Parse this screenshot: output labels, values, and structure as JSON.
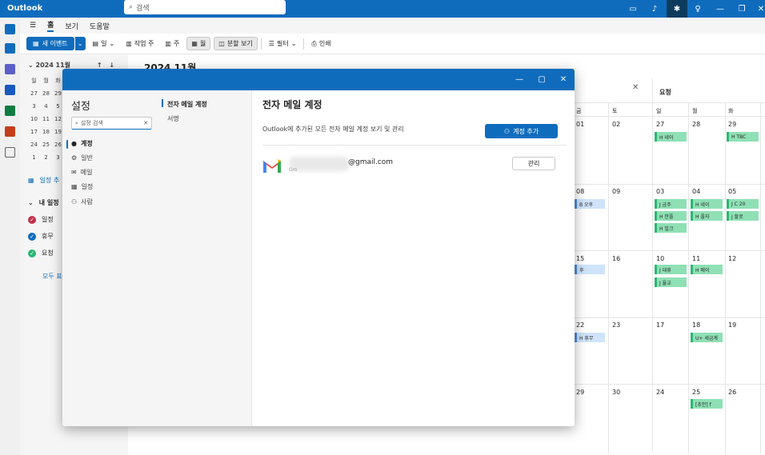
{
  "app": {
    "title": "Outlook"
  },
  "search": {
    "placeholder": "검색"
  },
  "menu": {
    "items": [
      "홈",
      "보기",
      "도움말"
    ],
    "active": "홈"
  },
  "ribbon": {
    "new_event": "새 이벤트",
    "day": "일",
    "work_week": "작업 주",
    "week": "주",
    "month": "월",
    "split_view": "분할 보기",
    "filter": "필터",
    "print": "인쇄"
  },
  "leftnav": {
    "month_label": "2024 11월",
    "weekdays": [
      "일",
      "월",
      "화"
    ],
    "weeks": [
      [
        "27",
        "28",
        "29"
      ],
      [
        "3",
        "4",
        "5"
      ],
      [
        "10",
        "11",
        "12"
      ],
      [
        "17",
        "18",
        "19"
      ],
      [
        "24",
        "25",
        "26"
      ],
      [
        "1",
        "2",
        "3"
      ]
    ],
    "add_calendar": "일정 추",
    "my_calendars": "내 일정",
    "calendars": [
      {
        "name": "일정",
        "color": "#c4314b"
      },
      {
        "name": "휴무",
        "color": "#0f6cbd"
      },
      {
        "name": "요청",
        "color": "#2bb673"
      }
    ],
    "show_all": "모두 표"
  },
  "calendar": {
    "today": "오늘",
    "month_title": "2024 11월",
    "panel_title": "요청",
    "col_headers": [
      "금",
      "토",
      "일",
      "월",
      "화"
    ],
    "dates": [
      [
        "01",
        "02",
        "27",
        "28",
        "29"
      ],
      [
        "08",
        "09",
        "03",
        "04",
        "05"
      ],
      [
        "15",
        "16",
        "10",
        "11",
        "12"
      ],
      [
        "22",
        "23",
        "17",
        "18",
        "19"
      ],
      [
        "29",
        "30",
        "24",
        "25",
        "26"
      ]
    ],
    "events": {
      "e1": "H 네이",
      "e2": "H TBC",
      "e3": "B 오후",
      "e4": "J 금주",
      "e5": "H 네이",
      "e6": "J C 20",
      "e7": "H 한플",
      "e8": "H 플자",
      "e9": "J 할로",
      "e10": "H 빌크",
      "e11": "J 대휴",
      "e12": "H 메이",
      "e13": "J 율교",
      "e14": "후",
      "e15": "H 휴무",
      "e16": "U+ 세금계",
      "e17": "[초안] f"
    }
  },
  "dialog": {
    "settings_title": "설정",
    "search_placeholder": "설정 검색",
    "categories": [
      "계정",
      "일반",
      "메일",
      "일정",
      "사람"
    ],
    "selected_category": "계정",
    "subcategories": [
      "전자 메일 계정",
      "서명"
    ],
    "content_title": "전자 메일 계정",
    "description": "Outlook에 추가된 모든 전자 메일 계정 보기 및 관리",
    "add_account": "계정 추가",
    "account_email": "@gmail.com",
    "account_provider": "Gm",
    "manage": "관리"
  }
}
